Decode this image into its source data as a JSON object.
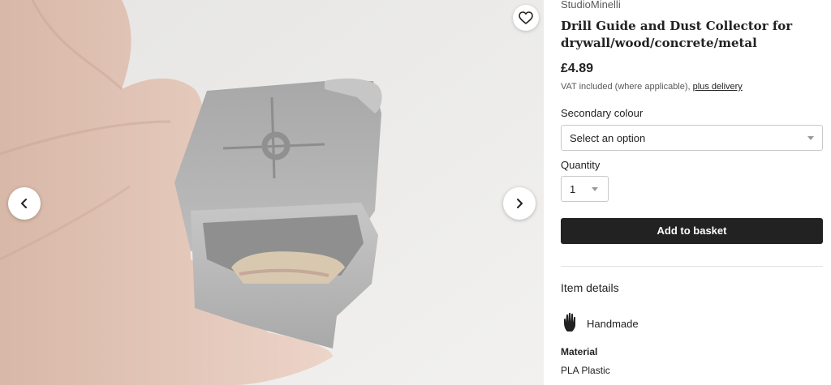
{
  "listing": {
    "shop_name": "StudioMinelli",
    "title": "Drill Guide and Dust Collector for drywall/wood/concrete/metal",
    "price": "£4.89",
    "vat_text": "VAT included (where applicable),",
    "delivery_link": "plus delivery"
  },
  "options": {
    "colour_label": "Secondary colour",
    "colour_placeholder": "Select an option",
    "quantity_label": "Quantity",
    "quantity_value": "1",
    "add_to_basket": "Add to basket"
  },
  "details": {
    "section_title": "Item details",
    "handmade": "Handmade",
    "material_label": "Material",
    "material_value": "PLA Plastic"
  },
  "icons": {
    "favorite": "heart-icon",
    "previous": "chevron-left-icon",
    "next": "chevron-right-icon",
    "handmade": "hand-icon"
  }
}
